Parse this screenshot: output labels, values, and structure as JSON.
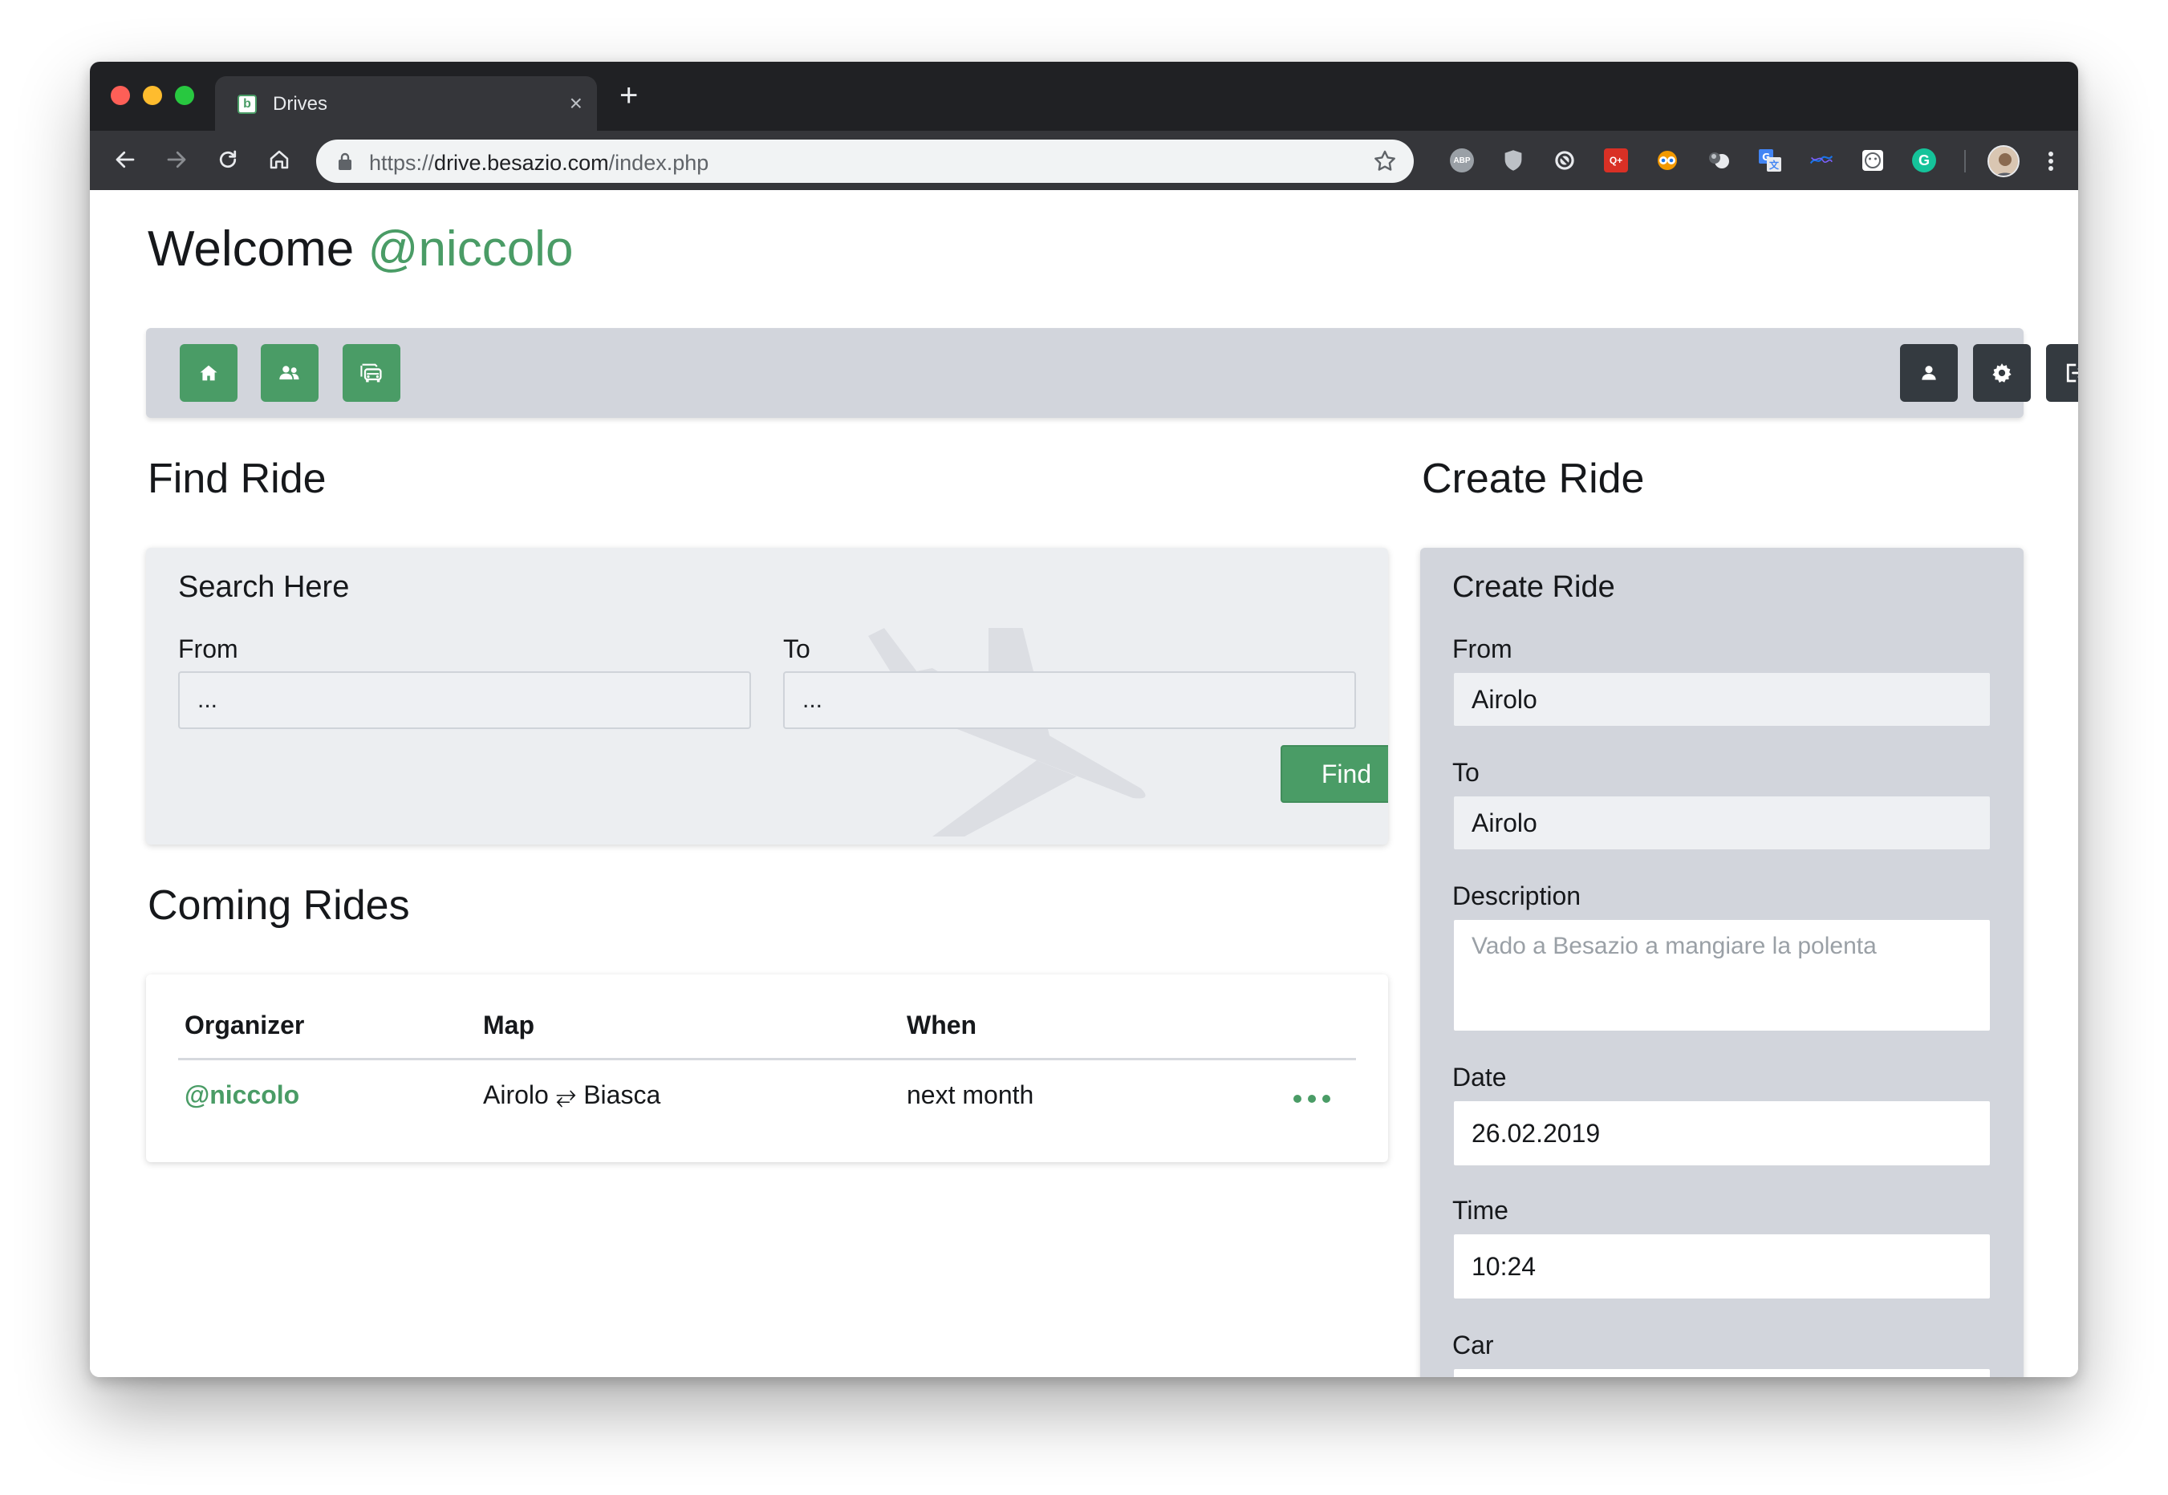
{
  "browser": {
    "tab_title": "Drives",
    "favicon_letter": "b",
    "url_scheme": "https://",
    "url_host": "drive.besazio.com",
    "url_path": "/index.php",
    "extensions": [
      "ABP",
      "shield",
      "block",
      "Q+",
      "eyes",
      "balls",
      "translate",
      "map",
      "face",
      "G"
    ]
  },
  "page": {
    "welcome_prefix": "Welcome",
    "username": "@niccolo",
    "nav_left": [
      "home-icon",
      "users-icon",
      "car-icon"
    ],
    "nav_right": [
      "user-icon",
      "gear-icon",
      "logout-icon"
    ],
    "colors": {
      "accent": "#4a9c66",
      "panel": "#d2d5dc",
      "dark_button": "#343a40"
    }
  },
  "find_ride": {
    "heading": "Find Ride",
    "card_title": "Search Here",
    "from_label": "From",
    "from_value": "...",
    "to_label": "To",
    "to_value": "...",
    "button_label": "Find"
  },
  "coming_rides": {
    "heading": "Coming Rides",
    "columns": [
      "Organizer",
      "Map",
      "When"
    ],
    "rows": [
      {
        "organizer": "@niccolo",
        "map": "Airolo ⥂ Biasca",
        "when": "next month"
      }
    ]
  },
  "create_ride": {
    "heading": "Create Ride",
    "card_title": "Create Ride",
    "from_label": "From",
    "from_value": "Airolo",
    "to_label": "To",
    "to_value": "Airolo",
    "description_label": "Description",
    "description_placeholder": "Vado a Besazio a mangiare la polenta",
    "date_label": "Date",
    "date_value": "26.02.2019",
    "time_label": "Time",
    "time_value": "10:24",
    "car_label": "Car"
  }
}
